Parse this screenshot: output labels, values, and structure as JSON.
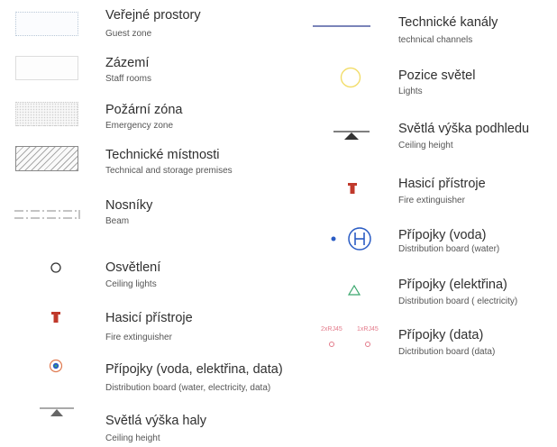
{
  "left_items": [
    {
      "icon": "guest-zone-swatch",
      "title": "Veřejné prostory",
      "subtitle": "Guest zone"
    },
    {
      "icon": "staff-rooms-swatch",
      "title": "Zázemí",
      "subtitle": "Staff rooms"
    },
    {
      "icon": "emergency-zone-swatch",
      "title": "Požární zóna",
      "subtitle": "Emergency zone"
    },
    {
      "icon": "technical-premises-hatch",
      "title": "Technické místnosti",
      "subtitle": "Technical and storage premises"
    },
    {
      "icon": "beam-dashdot-line",
      "title": "Nosníky",
      "subtitle": "Beam"
    },
    {
      "icon": "ceiling-light-circle-icon",
      "title": "Osvětlení",
      "subtitle": "Ceiling lights"
    },
    {
      "icon": "fire-extinguisher-icon",
      "title": "Hasicí přístroje",
      "subtitle": "Fire extinguisher"
    },
    {
      "icon": "distribution-board-combined-icon",
      "title": "Přípojky (voda, elektřina, data)",
      "subtitle": "Distribution board (water, electricity, data)"
    },
    {
      "icon": "ceiling-height-triangle-icon",
      "title": "Světlá výška haly",
      "subtitle": "Ceiling height"
    }
  ],
  "right_items": [
    {
      "icon": "technical-channels-line",
      "title": "Technické kanály",
      "subtitle": "technical channels"
    },
    {
      "icon": "lights-circle-icon",
      "title": "Pozice světel",
      "subtitle": "Lights"
    },
    {
      "icon": "ceiling-height-triangle-icon",
      "title": "Světlá výška podhledu",
      "subtitle": "Ceiling height"
    },
    {
      "icon": "fire-extinguisher-icon",
      "title": "Hasicí přístroje",
      "subtitle": "Fire extinguisher"
    },
    {
      "icon": "water-board-h-icon",
      "title": "Přípojky (voda)",
      "subtitle": "Distribution board (water)"
    },
    {
      "icon": "electricity-triangle-icon",
      "title": "Přípojky (elektřina)",
      "subtitle": "Distribution board ( electricity)"
    },
    {
      "icon": "data-sockets-icon",
      "title": "Přípojky (data)",
      "subtitle": "Dictribution board (data)",
      "icon_labels": [
        "2xRJ45",
        "1xRJ45"
      ]
    }
  ],
  "colors": {
    "text": "#2f2f2f",
    "subtext": "#555555",
    "channel_line": "#2b3a8f",
    "light_circle": "#f2dd6a",
    "extinguisher": "#c0392b",
    "water_blue": "#2a5cc4",
    "electric_green": "#3aa76d",
    "data_pink": "#e37a8a"
  }
}
